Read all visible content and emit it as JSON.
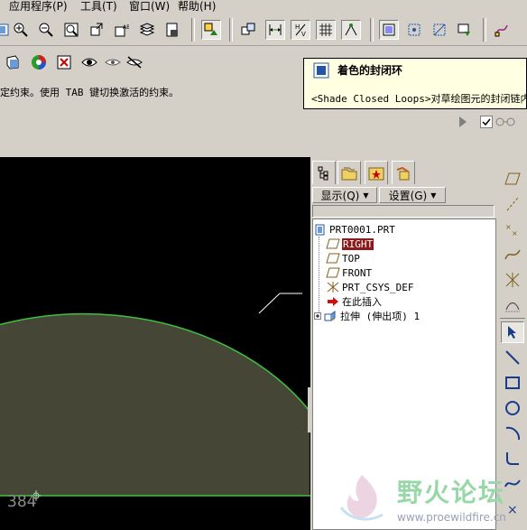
{
  "menu": {
    "items": [
      "应用程序(P)",
      "工具(T)",
      "窗口(W)",
      "帮助(H)"
    ]
  },
  "status": {
    "message": "定约束。使用 TAB 键切换激活的约束。"
  },
  "tooltip": {
    "title": "着色的封闭环",
    "description": "<Shade Closed Loops>对草绘图元的封闭链内"
  },
  "panel": {
    "show_label": "显示(Q)",
    "settings_label": "设置(G)"
  },
  "tree": {
    "items": [
      {
        "label": "PRT0001.PRT",
        "icon": "part-icon"
      },
      {
        "label": "RIGHT",
        "icon": "datum-plane-icon"
      },
      {
        "label": "TOP",
        "icon": "datum-plane-icon"
      },
      {
        "label": "FRONT",
        "icon": "datum-plane-icon"
      },
      {
        "label": "PRT_CSYS_DEF",
        "icon": "csys-icon"
      },
      {
        "label": "在此插入",
        "icon": "insert-arrow-icon"
      },
      {
        "label": "拉伸 (伸出项) 1",
        "icon": "extrude-icon"
      }
    ]
  },
  "canvas": {
    "dimension_text": "384"
  },
  "watermark": {
    "title": "野火论坛",
    "url": "www.proewildfire.cn"
  },
  "colors": {
    "background": "#d4d0c8",
    "canvas": "#000000",
    "shaded_region": "#464637",
    "sketch_line": "#3fbf3f",
    "selection": "#8b1a1a",
    "tooltip": "#ffffe1"
  }
}
